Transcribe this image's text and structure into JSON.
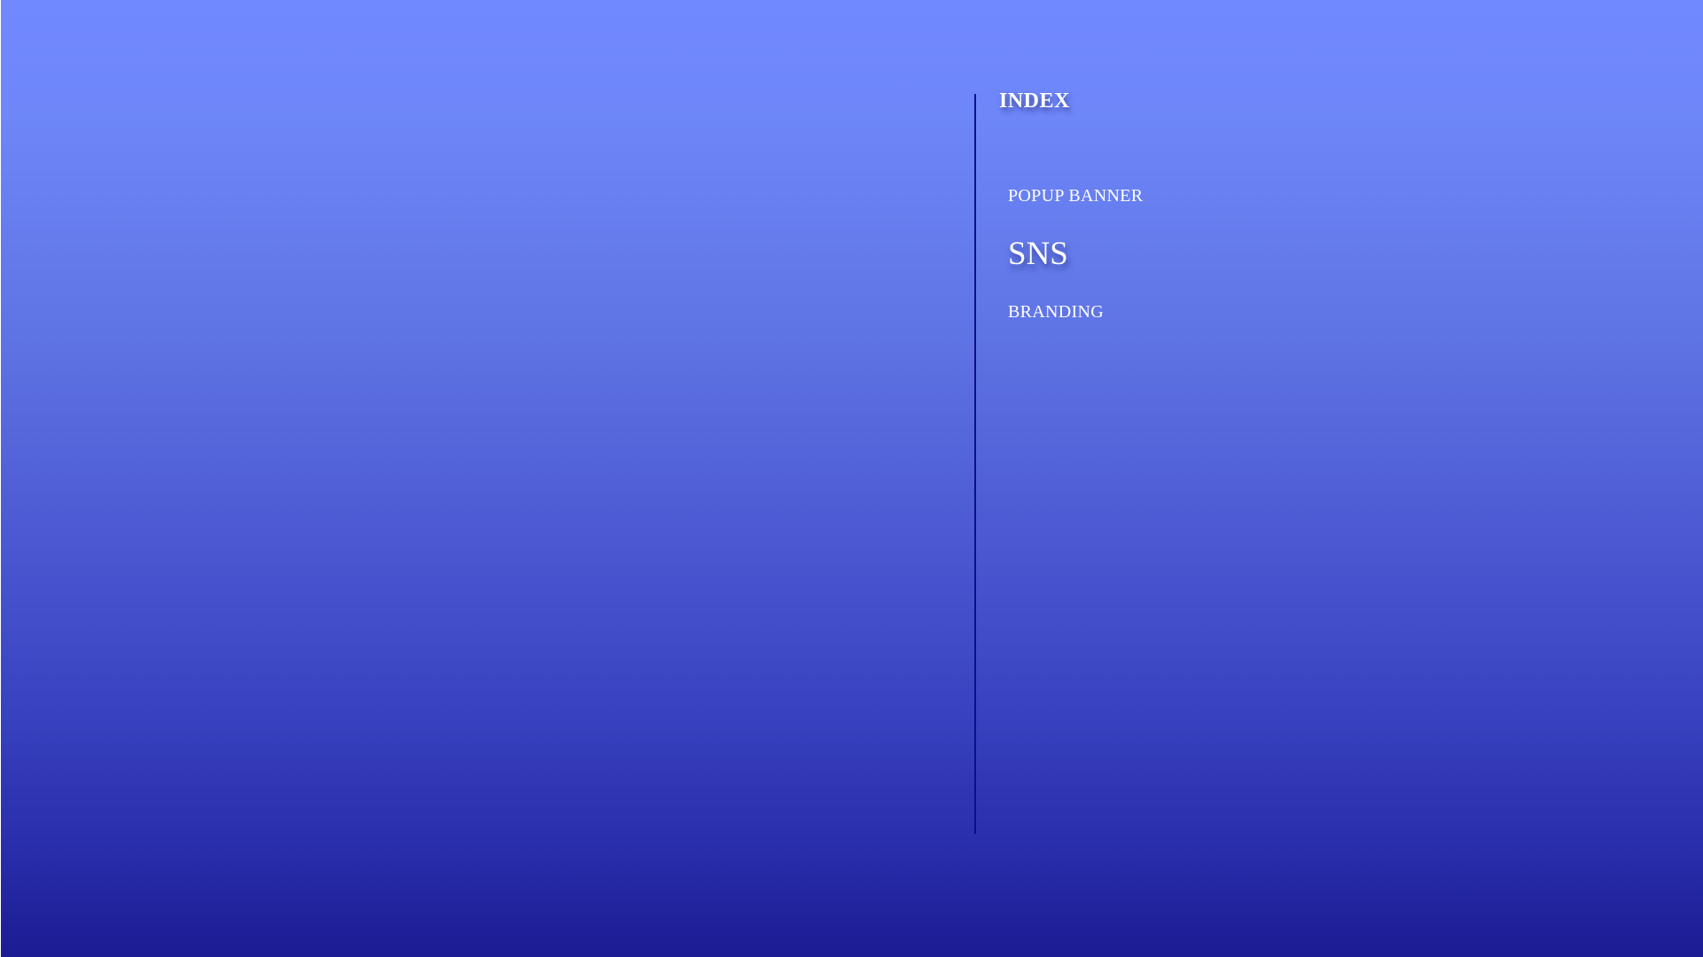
{
  "index": {
    "title": "INDEX",
    "items": [
      {
        "label": "POPUP BANNER",
        "active": false
      },
      {
        "label": "SNS",
        "active": true
      },
      {
        "label": "BRANDING",
        "active": false
      }
    ]
  },
  "colors": {
    "background_top": "#7189ff",
    "background_bottom": "#1c1c93",
    "divider": "#0b0f8c",
    "text": "#ffffff"
  }
}
